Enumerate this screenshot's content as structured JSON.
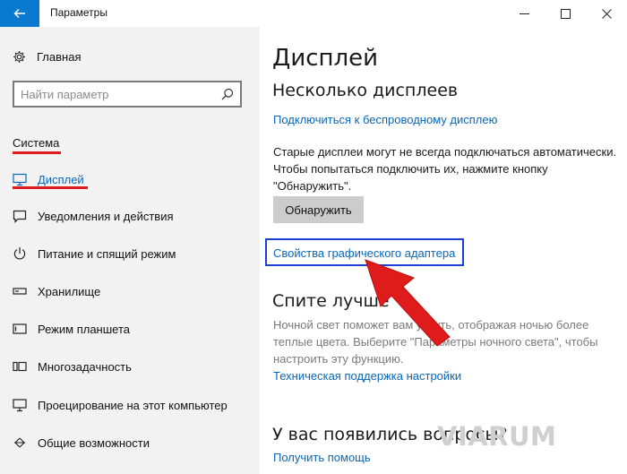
{
  "window": {
    "title": "Параметры"
  },
  "sidebar": {
    "home_label": "Главная",
    "search_placeholder": "Найти параметр",
    "section_label": "Система",
    "items": [
      {
        "label": "Дисплей",
        "icon": "monitor-icon",
        "active": true
      },
      {
        "label": "Уведомления и действия",
        "icon": "notifications-icon"
      },
      {
        "label": "Питание и спящий режим",
        "icon": "power-icon"
      },
      {
        "label": "Хранилище",
        "icon": "storage-icon"
      },
      {
        "label": "Режим планшета",
        "icon": "tablet-icon"
      },
      {
        "label": "Многозадачность",
        "icon": "multitasking-icon"
      },
      {
        "label": "Проецирование на этот компьютер",
        "icon": "projection-icon"
      },
      {
        "label": "Общие возможности",
        "icon": "shared-experiences-icon"
      }
    ]
  },
  "main": {
    "title": "Дисплей",
    "multi_heading": "Несколько дисплеев",
    "wireless_link": "Подключиться к беспроводному дисплею",
    "old_displays_text": "Старые дисплеи могут не всегда подключаться автоматически. Чтобы попытаться подключить их, нажмите кнопку \"Обнаружить\".",
    "detect_button": "Обнаружить",
    "adapter_link": "Свойства графического адаптера",
    "sleep_heading": "Спите лучше",
    "night_light_text": "Ночной свет поможет вам уснуть, отображая ночью более теплые цвета. Выберите \"Параметры ночного света\", чтобы настроить эту функцию.",
    "tech_support_link": "Техническая поддержка настройки",
    "questions_heading": "У вас появились вопросы?",
    "help_link": "Получить помощь"
  },
  "watermark": "VIARUM",
  "colors": {
    "accent": "#0a7ad1",
    "link": "#0a66b8",
    "annotation_red": "#e01b1b",
    "annotation_blue": "#1c3fd6"
  }
}
